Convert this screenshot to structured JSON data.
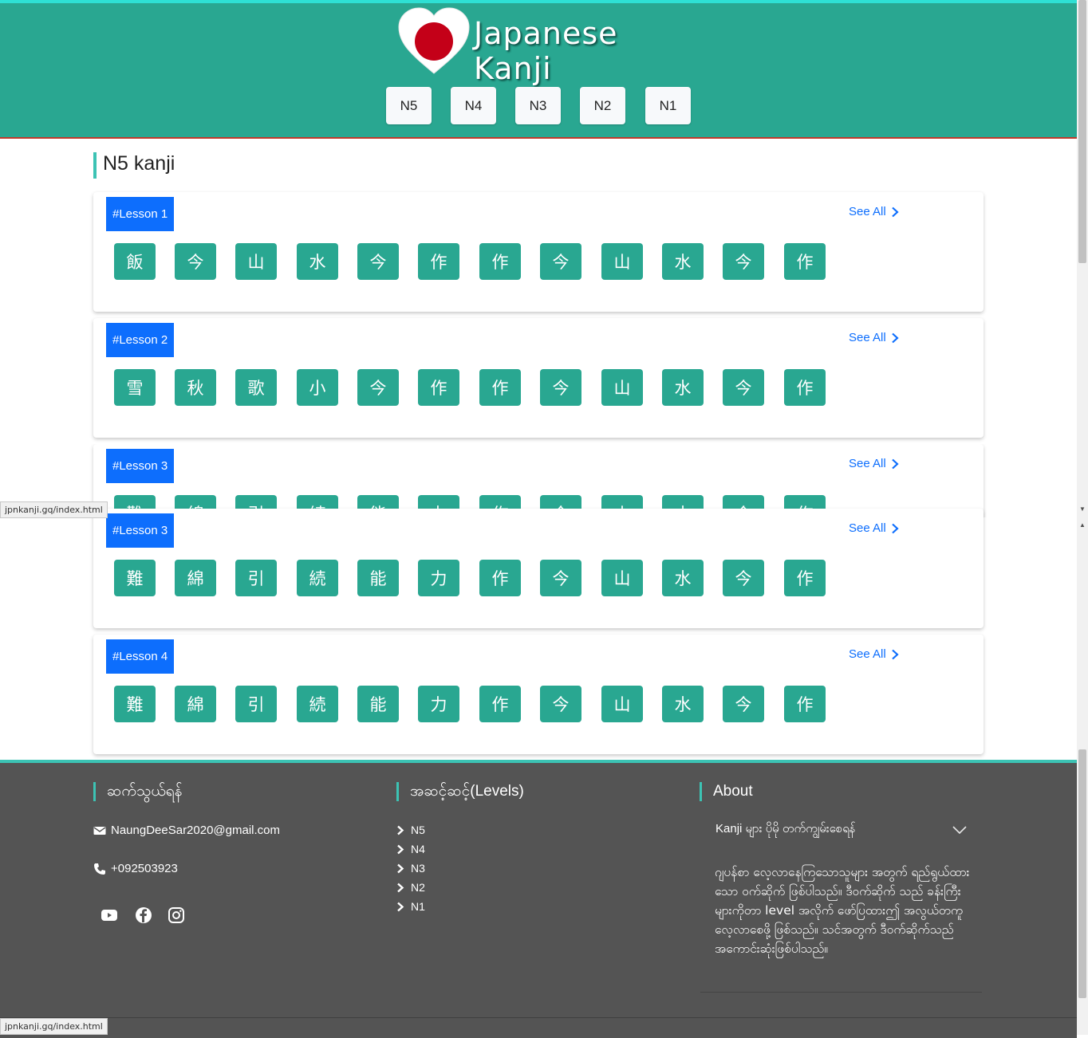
{
  "header": {
    "title": "Japanese Kanji",
    "levels": [
      "N5",
      "N4",
      "N3",
      "N2",
      "N1"
    ]
  },
  "page_title": "N5 kanji",
  "see_all": "See All",
  "lessons": [
    {
      "badge": "#Lesson 1",
      "kanji": [
        "飯",
        "今",
        "山",
        "水",
        "今",
        "作",
        "作",
        "今",
        "山",
        "水",
        "今",
        "作"
      ]
    },
    {
      "badge": "#Lesson 2",
      "kanji": [
        "雪",
        "秋",
        "歌",
        "小",
        "今",
        "作",
        "作",
        "今",
        "山",
        "水",
        "今",
        "作"
      ]
    },
    {
      "badge": "#Lesson 3",
      "kanji": [
        "難",
        "綿",
        "引",
        "続",
        "能",
        "力",
        "作",
        "今",
        "山",
        "水",
        "今",
        "作"
      ]
    },
    {
      "badge": "#Lesson 3",
      "kanji": [
        "難",
        "綿",
        "引",
        "続",
        "能",
        "力",
        "作",
        "今",
        "山",
        "水",
        "今",
        "作"
      ]
    },
    {
      "badge": "#Lesson  4",
      "kanji": [
        "難",
        "綿",
        "引",
        "続",
        "能",
        "力",
        "作",
        "今",
        "山",
        "水",
        "今",
        "作"
      ]
    }
  ],
  "status_url": "jpnkanji.gq/index.html",
  "footer": {
    "contact_heading": "ဆက်သွယ်ရန်",
    "email": "NaungDeeSar2020@gmail.com",
    "phone": "+092503923",
    "social_icons": [
      "youtube-icon",
      "facebook-icon",
      "instagram-icon"
    ],
    "levels_heading": "အဆင့်ဆင့်(Levels)",
    "levels": [
      "N5",
      "N4",
      "N3",
      "N2",
      "N1"
    ],
    "about_heading": "About",
    "about_question": "Kanji များ ပိုမို တက်ကျွမ်းစေရန်",
    "about_text": "ဂျပန်စာ လေ့လာနေကြသောသူများ အတွက် ရည်ရွယ်ထားသော ဝက်ဆိုက် ဖြစ်ပါသည်။ ဒီဝက်ဆိုက် သည် ခန်းကြီးများကိုတာ level အလိုက် ဖော်ပြထားဤ အလွယ်တကူ လေ့လာစေဖို့ ဖြစ်သည်။ သင်အတွက် ဒီဝက်ဆိုက်သည် အကောင်းဆုံးဖြစ်ပါသည်။"
  },
  "colors": {
    "header_bg": "#29a791",
    "accent": "#3cc3b4",
    "badge": "#0d6efd",
    "footer_bg": "#545454"
  }
}
